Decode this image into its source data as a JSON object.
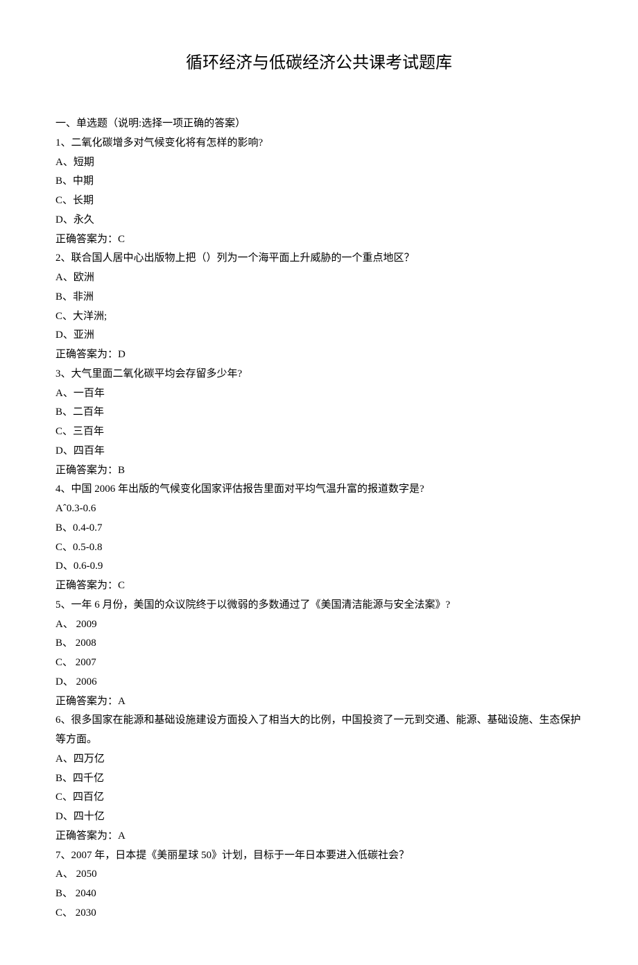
{
  "title": "循环经济与低碳经济公共课考试题库",
  "section_header": "一、单选题（说明:选择一项正确的答案）",
  "questions": [
    {
      "q": "1、二氧化碳增多对气候变化将有怎样的影响?",
      "opts": [
        "A、短期",
        "B、中期",
        "C、长期",
        "D、永久"
      ],
      "ans": "正确答案为：C"
    },
    {
      "q": "2、联合国人居中心出版物上把（）列为一个海平面上升威胁的一个重点地区？",
      "opts": [
        "A、欧洲",
        "B、非洲",
        "C、大洋洲;",
        "D、亚洲"
      ],
      "ans": "正确答案为：D"
    },
    {
      "q": "3、大气里面二氧化碳平均会存留多少年?",
      "opts": [
        "A、一百年",
        "B、二百年",
        "C、三百年",
        "D、四百年"
      ],
      "ans": "正确答案为：B"
    },
    {
      "q": "4、中国 2006 年出版的气候变化国家评估报告里面对平均气温升富的报道数字是?",
      "opts": [
        "Aˆ0.3-0.6",
        "B、0.4-0.7",
        "C、0.5-0.8",
        "D、0.6-0.9"
      ],
      "ans": "正确答案为：C"
    },
    {
      "q": "5、一年 6 月份，美国的众议院终于以微弱的多数通过了《美国清洁能源与安全法案》?",
      "opts": [
        "A、  2009",
        "B、  2008",
        "C、  2007",
        "D、  2006"
      ],
      "ans": "正确答案为：A"
    },
    {
      "q": "6、很多国家在能源和基础设施建设方面投入了相当大的比例，中国投资了一元到交通、能源、基础设施、生态保护等方面。",
      "opts": [
        "A、四万亿",
        "B、四千亿",
        "C、四百亿",
        "D、四十亿"
      ],
      "ans": "正确答案为：A"
    },
    {
      "q": "7、2007 年，日本提《美丽星球 50》计划，目标于一年日本要进入低碳社会？",
      "opts": [
        "A、  2050",
        "B、  2040",
        "C、  2030"
      ],
      "ans": ""
    }
  ]
}
